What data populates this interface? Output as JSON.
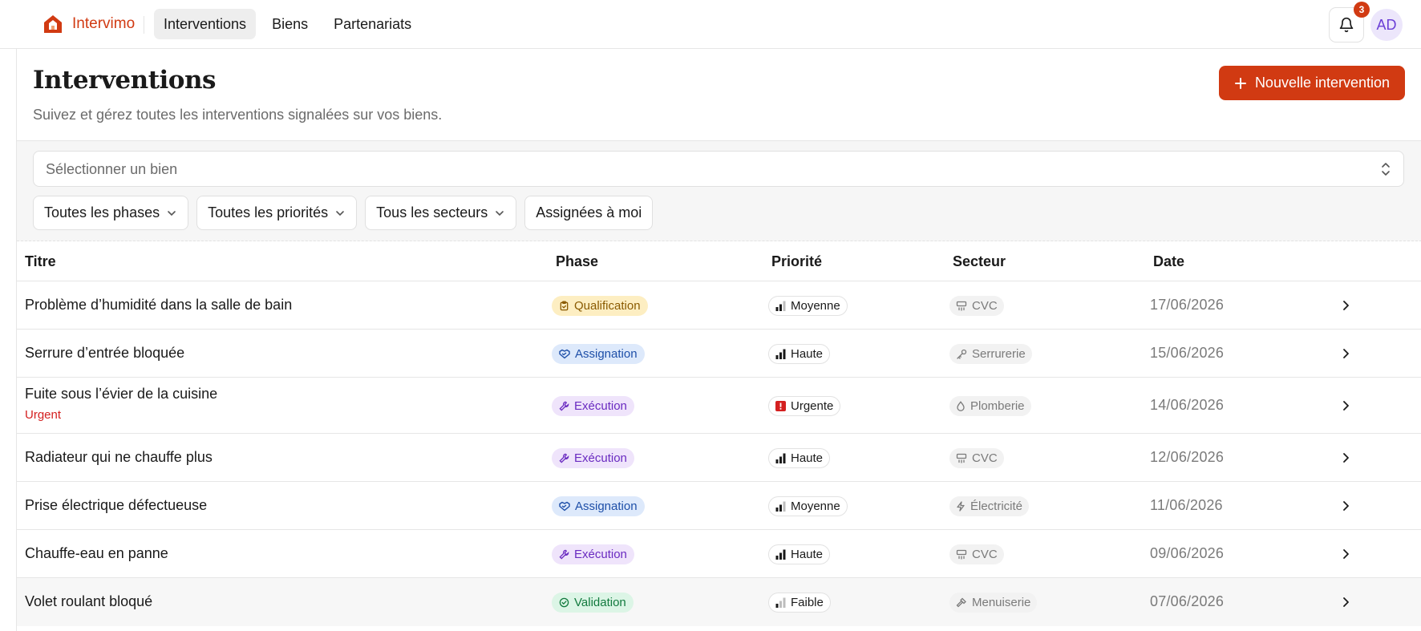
{
  "colors": {
    "brand": "#d13a12",
    "phase_qualification": {
      "bg": "#fdeec2",
      "fg": "#8a5a00"
    },
    "phase_assignation": {
      "bg": "#dde9fb",
      "fg": "#1e4fa8"
    },
    "phase_execution": {
      "bg": "#efe4fb",
      "fg": "#6a2bc1"
    },
    "phase_validation": {
      "bg": "#dcf5e6",
      "fg": "#127a3e"
    },
    "urgent": "#d42020"
  },
  "brand": {
    "name": "Intervimo",
    "icon": "house-logo-icon"
  },
  "nav": [
    {
      "label": "Interventions",
      "active": true
    },
    {
      "label": "Biens",
      "active": false
    },
    {
      "label": "Partenariats",
      "active": false
    }
  ],
  "notifications": {
    "count": "3",
    "icon": "bell-icon"
  },
  "user": {
    "initials": "AD"
  },
  "page": {
    "title": "Interventions",
    "subtitle": "Suivez et gérez toutes les interventions signalées sur vos biens.",
    "new_button": "Nouvelle intervention"
  },
  "filters": {
    "bien_placeholder": "Sélectionner un bien",
    "phase": "Toutes les phases",
    "priority": "Toutes les priorités",
    "sector": "Tous les secteurs",
    "assigned": "Assignées à moi"
  },
  "table": {
    "headers": {
      "title": "Titre",
      "phase": "Phase",
      "priority": "Priorité",
      "sector": "Secteur",
      "date": "Date"
    },
    "rows": [
      {
        "title": "Problème d’humidité dans la salle de bain",
        "subtitle": "",
        "phase": "Qualification",
        "phase_key": "qualification",
        "priority": "Moyenne",
        "priority_key": "moyenne",
        "sector": "CVC",
        "sector_icon": "hvac-icon",
        "date": "17/06/2026"
      },
      {
        "title": "Serrure d’entrée bloquée",
        "subtitle": "",
        "phase": "Assignation",
        "phase_key": "assignation",
        "priority": "Haute",
        "priority_key": "haute",
        "sector": "Serrurerie",
        "sector_icon": "key-icon",
        "date": "15/06/2026"
      },
      {
        "title": "Fuite sous l’évier de la cuisine",
        "subtitle": "Urgent",
        "phase": "Exécution",
        "phase_key": "execution",
        "priority": "Urgente",
        "priority_key": "urgente",
        "sector": "Plomberie",
        "sector_icon": "droplet-icon",
        "date": "14/06/2026"
      },
      {
        "title": "Radiateur qui ne chauffe plus",
        "subtitle": "",
        "phase": "Exécution",
        "phase_key": "execution",
        "priority": "Haute",
        "priority_key": "haute",
        "sector": "CVC",
        "sector_icon": "hvac-icon",
        "date": "12/06/2026"
      },
      {
        "title": "Prise électrique défectueuse",
        "subtitle": "",
        "phase": "Assignation",
        "phase_key": "assignation",
        "priority": "Moyenne",
        "priority_key": "moyenne",
        "sector": "Électricité",
        "sector_icon": "bolt-icon",
        "date": "11/06/2026"
      },
      {
        "title": "Chauffe-eau en panne",
        "subtitle": "",
        "phase": "Exécution",
        "phase_key": "execution",
        "priority": "Haute",
        "priority_key": "haute",
        "sector": "CVC",
        "sector_icon": "hvac-icon",
        "date": "09/06/2026"
      },
      {
        "title": "Volet roulant bloqué",
        "subtitle": "",
        "phase": "Validation",
        "phase_key": "validation",
        "priority": "Faible",
        "priority_key": "faible",
        "sector": "Menuiserie",
        "sector_icon": "hammer-icon",
        "date": "07/06/2026"
      }
    ]
  }
}
